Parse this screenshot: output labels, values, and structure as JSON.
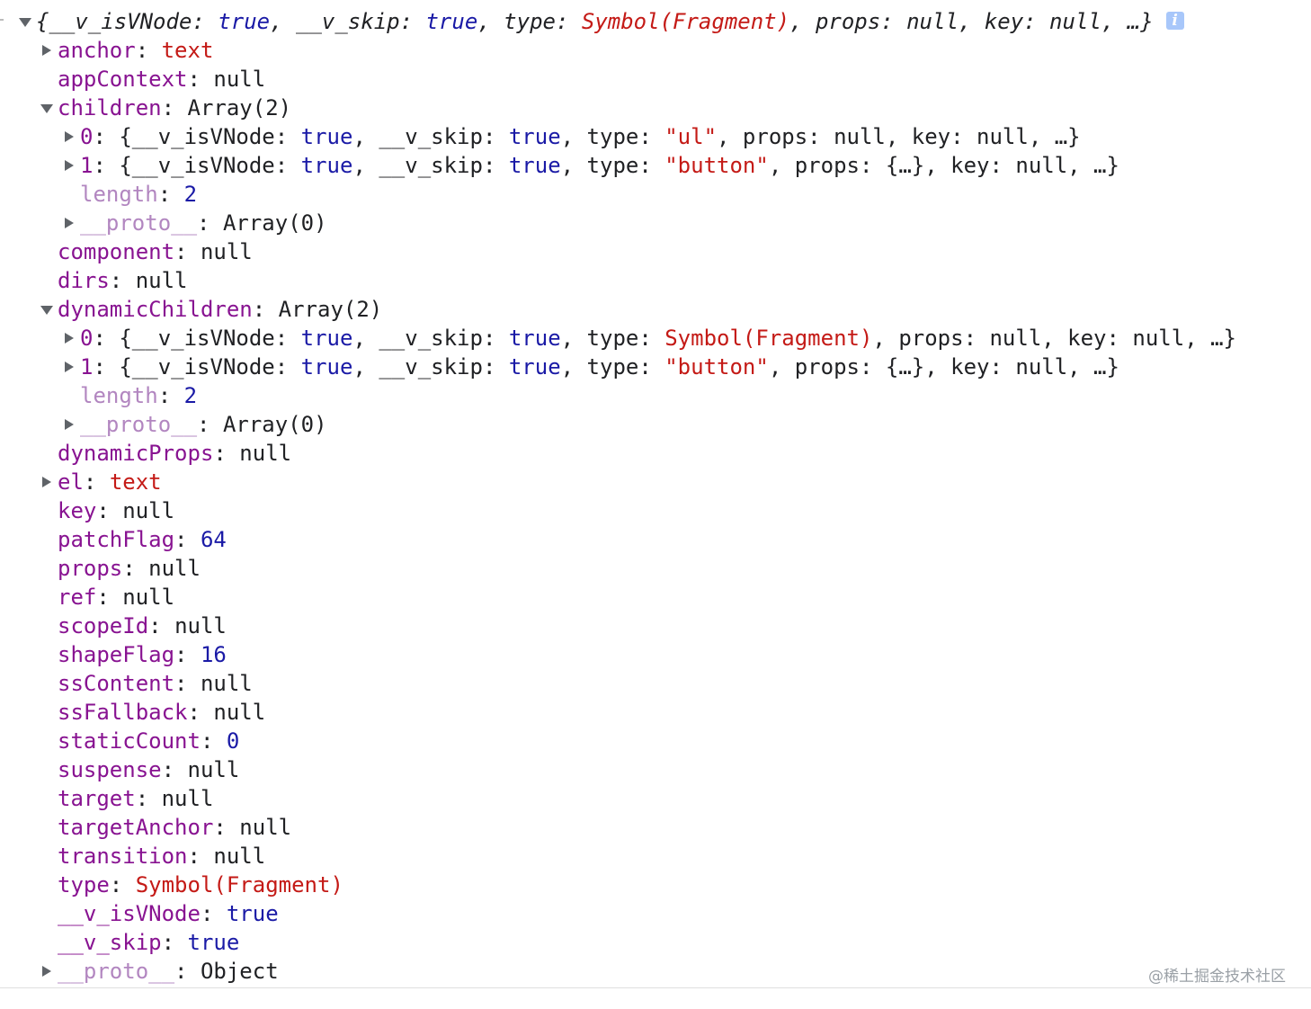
{
  "console": {
    "root_summary": "{__v_isVNode: true, __v_skip: true, type: Symbol(Fragment), props: null, key: null, …}",
    "entries": [
      {
        "indent": 1,
        "toggle": "collapsed",
        "key": "anchor",
        "value": "text",
        "type": "string"
      },
      {
        "indent": 1,
        "toggle": "none",
        "key": "appContext",
        "value": "null",
        "type": "null"
      },
      {
        "indent": 1,
        "toggle": "expanded",
        "key": "children",
        "value": "Array(2)",
        "type": "plain"
      },
      {
        "indent": 2,
        "toggle": "collapsed",
        "key": "0",
        "value": "{__v_isVNode: true, __v_skip: true, type: \"ul\", props: null, key: null, …}",
        "type": "preview",
        "preview_type": "\"ul\"",
        "preview_props": "null"
      },
      {
        "indent": 2,
        "toggle": "collapsed",
        "key": "1",
        "value": "{__v_isVNode: true, __v_skip: true, type: \"button\", props: {…}, key: null, …}",
        "type": "preview",
        "preview_type": "\"button\"",
        "preview_props": "{…}"
      },
      {
        "indent": 2,
        "toggle": "none",
        "key": "length",
        "value": "2",
        "type": "number",
        "dim": true
      },
      {
        "indent": 2,
        "toggle": "collapsed",
        "key": "__proto__",
        "value": "Array(0)",
        "type": "plain",
        "dim": true
      },
      {
        "indent": 1,
        "toggle": "none",
        "key": "component",
        "value": "null",
        "type": "null"
      },
      {
        "indent": 1,
        "toggle": "none",
        "key": "dirs",
        "value": "null",
        "type": "null"
      },
      {
        "indent": 1,
        "toggle": "expanded",
        "key": "dynamicChildren",
        "value": "Array(2)",
        "type": "plain"
      },
      {
        "indent": 2,
        "toggle": "collapsed",
        "key": "0",
        "value": "{__v_isVNode: true, __v_skip: true, type: Symbol(Fragment), props: null, key: null, …}",
        "type": "preview",
        "preview_type": "Symbol(Fragment)",
        "preview_props": "null"
      },
      {
        "indent": 2,
        "toggle": "collapsed",
        "key": "1",
        "value": "{__v_isVNode: true, __v_skip: true, type: \"button\", props: {…}, key: null, …}",
        "type": "preview",
        "preview_type": "\"button\"",
        "preview_props": "{…}"
      },
      {
        "indent": 2,
        "toggle": "none",
        "key": "length",
        "value": "2",
        "type": "number",
        "dim": true
      },
      {
        "indent": 2,
        "toggle": "collapsed",
        "key": "__proto__",
        "value": "Array(0)",
        "type": "plain",
        "dim": true
      },
      {
        "indent": 1,
        "toggle": "none",
        "key": "dynamicProps",
        "value": "null",
        "type": "null"
      },
      {
        "indent": 1,
        "toggle": "collapsed",
        "key": "el",
        "value": "text",
        "type": "string"
      },
      {
        "indent": 1,
        "toggle": "none",
        "key": "key",
        "value": "null",
        "type": "null"
      },
      {
        "indent": 1,
        "toggle": "none",
        "key": "patchFlag",
        "value": "64",
        "type": "number"
      },
      {
        "indent": 1,
        "toggle": "none",
        "key": "props",
        "value": "null",
        "type": "null"
      },
      {
        "indent": 1,
        "toggle": "none",
        "key": "ref",
        "value": "null",
        "type": "null"
      },
      {
        "indent": 1,
        "toggle": "none",
        "key": "scopeId",
        "value": "null",
        "type": "null"
      },
      {
        "indent": 1,
        "toggle": "none",
        "key": "shapeFlag",
        "value": "16",
        "type": "number"
      },
      {
        "indent": 1,
        "toggle": "none",
        "key": "ssContent",
        "value": "null",
        "type": "null"
      },
      {
        "indent": 1,
        "toggle": "none",
        "key": "ssFallback",
        "value": "null",
        "type": "null"
      },
      {
        "indent": 1,
        "toggle": "none",
        "key": "staticCount",
        "value": "0",
        "type": "number"
      },
      {
        "indent": 1,
        "toggle": "none",
        "key": "suspense",
        "value": "null",
        "type": "null"
      },
      {
        "indent": 1,
        "toggle": "none",
        "key": "target",
        "value": "null",
        "type": "null"
      },
      {
        "indent": 1,
        "toggle": "none",
        "key": "targetAnchor",
        "value": "null",
        "type": "null"
      },
      {
        "indent": 1,
        "toggle": "none",
        "key": "transition",
        "value": "null",
        "type": "null"
      },
      {
        "indent": 1,
        "toggle": "none",
        "key": "type",
        "value": "Symbol(Fragment)",
        "type": "symbol"
      },
      {
        "indent": 1,
        "toggle": "none",
        "key": "__v_isVNode",
        "value": "true",
        "type": "bool"
      },
      {
        "indent": 1,
        "toggle": "none",
        "key": "__v_skip",
        "value": "true",
        "type": "bool"
      },
      {
        "indent": 1,
        "toggle": "collapsed",
        "key": "__proto__",
        "value": "Object",
        "type": "plain",
        "dim": true
      }
    ]
  },
  "watermark": "@稀土掘金技术社区",
  "colors": {
    "key": "#881391",
    "key_dim": "#b286c0",
    "keyword": "#1a1aa6",
    "string": "#c41a16",
    "number": "#1a1aa6",
    "text": "#202124",
    "info_icon": "#a8c7fa"
  }
}
